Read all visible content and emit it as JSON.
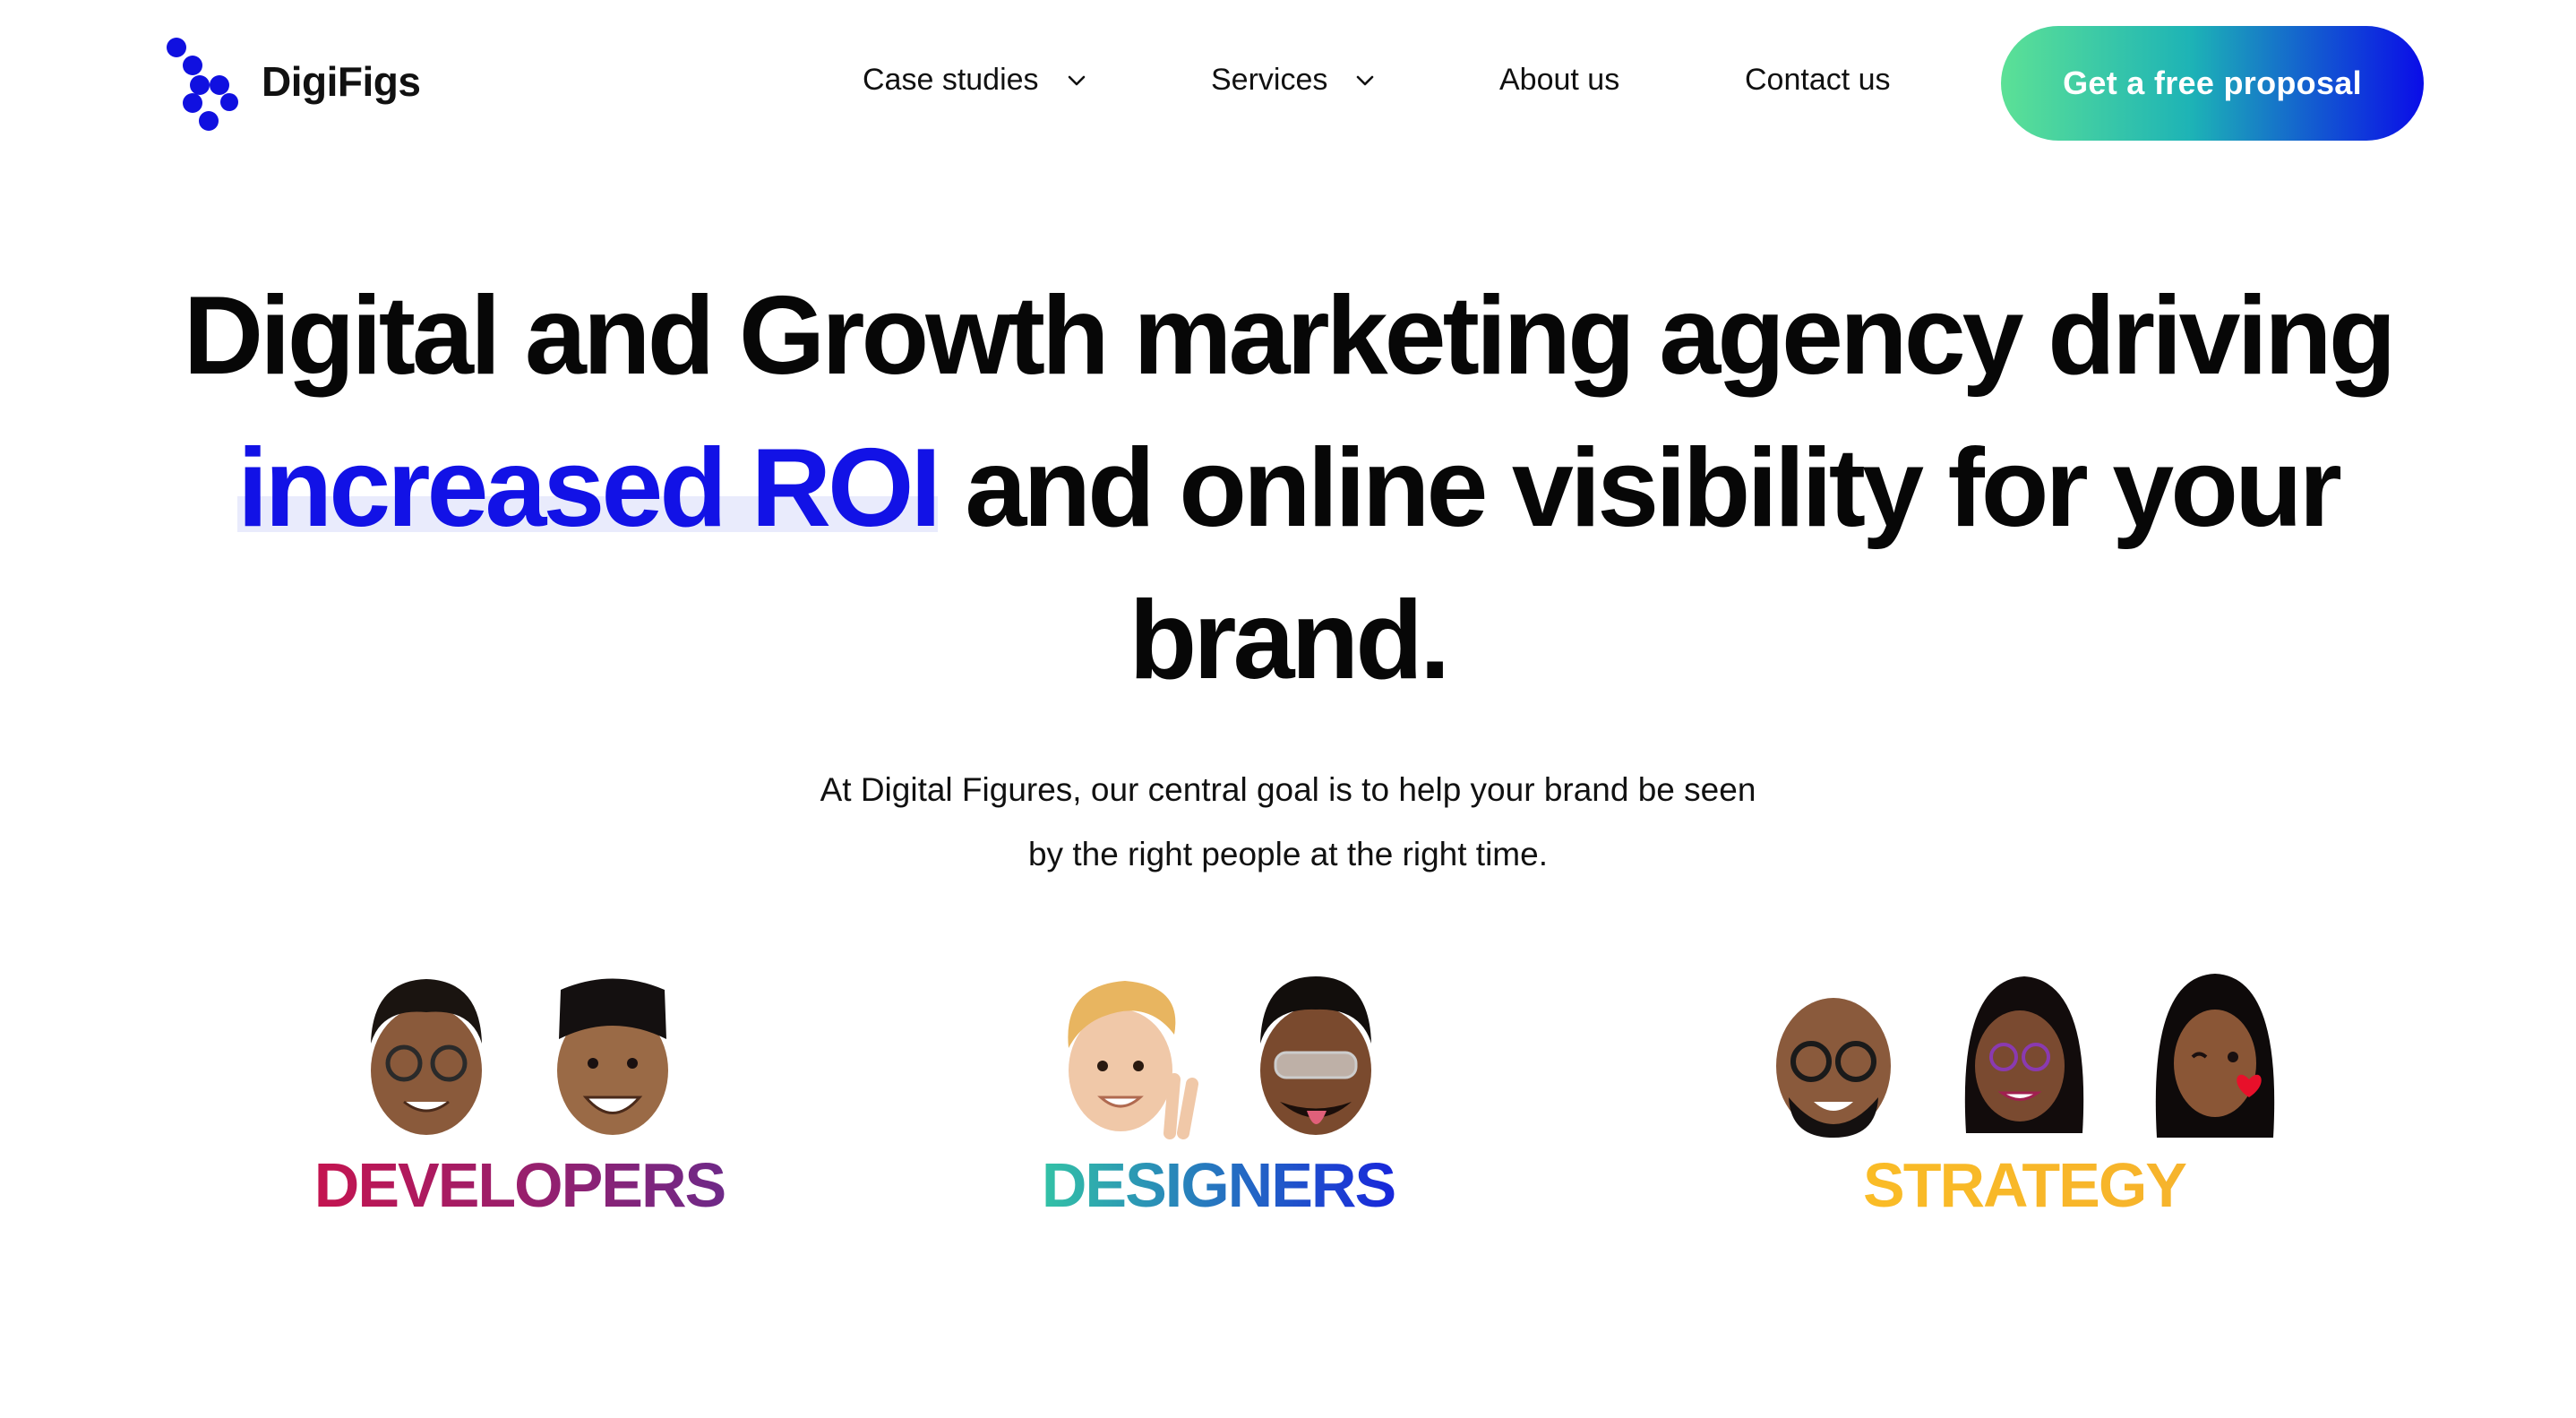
{
  "brand": {
    "name": "DigiFigs",
    "logo_color": "#1010e0"
  },
  "nav": {
    "items": [
      {
        "label": "Case studies",
        "dropdown": true
      },
      {
        "label": "Services",
        "dropdown": true
      },
      {
        "label": "About us",
        "dropdown": false
      },
      {
        "label": "Contact us",
        "dropdown": false
      }
    ],
    "cta_label": "Get a free proposal"
  },
  "hero": {
    "line1": "Digital and Growth marketing agency driving",
    "accent": "increased ROI",
    "line2_rest": " and online visibility for your",
    "line3": "brand.",
    "accent_color": "#1212e6"
  },
  "subtitle": {
    "line1": "At Digital Figures, our central goal is to help your brand be seen",
    "line2": "by the right people at the right time."
  },
  "teams": [
    {
      "label": "DEVELOPERS",
      "gradient": [
        "#c8134d",
        "#6a2a8a"
      ],
      "avatars": 2
    },
    {
      "label": "DESIGNERS",
      "gradient": [
        "#36d3a0",
        "#1515e0"
      ],
      "avatars": 2
    },
    {
      "label": "STRATEGY",
      "gradient": [
        "#fbbf24",
        "#f5b02e"
      ],
      "avatars": 3
    }
  ]
}
